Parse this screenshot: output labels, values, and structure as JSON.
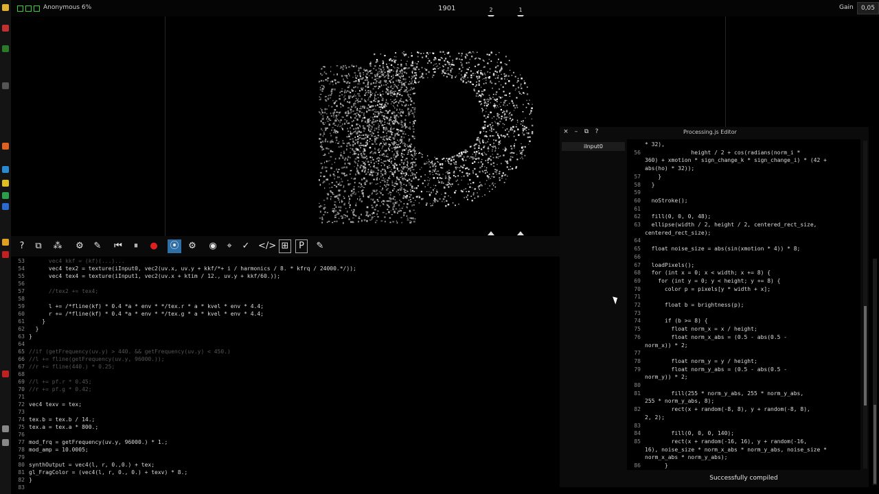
{
  "app": {
    "title": "Anonymous 6%",
    "frame": "1901"
  },
  "markers": [
    "2",
    "1"
  ],
  "gain": {
    "label": "Gain",
    "value": "0,05"
  },
  "toolbar": {
    "icons": [
      "help-icon",
      "windows-icon",
      "people-icon",
      "gear-icon",
      "brush-icon",
      "skip-back-icon",
      "pause-icon",
      "record-icon",
      "waveform-icon",
      "settings-icon",
      "eye-icon",
      "binoculars-icon",
      "check-icon",
      "code-icon",
      "add-icon",
      "processing-icon",
      "brush-icon"
    ],
    "glyphs": [
      "?",
      "⧉",
      "⁂",
      "⚙",
      "✎",
      "⏮",
      "⏸",
      "●",
      "⦿",
      "⚙",
      "◉",
      "⌖",
      "✓",
      "</>",
      "⊞",
      "P",
      "✎"
    ]
  },
  "code_lines": [
    {
      "n": "53",
      "t": "      vec4 kkf = (kf)(...)...",
      "d": true
    },
    {
      "n": "54",
      "t": "      vec4 tex2 = texture(iInput0, vec2(uv.x, uv.y + kkf/*+ i / harmonics / 8. * kfrq / 24000.*/));"
    },
    {
      "n": "55",
      "t": "      vec4 tex4 = texture(iInput1, vec2(uv.x + ktim / 12., uv.y + kkf/60.));"
    },
    {
      "n": "56",
      "t": ""
    },
    {
      "n": "57",
      "t": "      //tex2 += tex4;",
      "d": true
    },
    {
      "n": "58",
      "t": ""
    },
    {
      "n": "59",
      "t": "      l += /*fline(kf) * 0.4 *a * env * */tex.r * a * kvel * env * 4.4;"
    },
    {
      "n": "60",
      "t": "      r += /*fline(kf) * 0.4 *a * env * */tex.g * a * kvel * env * 4.4;"
    },
    {
      "n": "61",
      "t": "    }"
    },
    {
      "n": "62",
      "t": "  }"
    },
    {
      "n": "63",
      "t": "}"
    },
    {
      "n": "64",
      "t": ""
    },
    {
      "n": "65",
      "t": "//if (getFrequency(uv.y) > 440. && getFrequency(uv.y) < 450.)",
      "d": true
    },
    {
      "n": "66",
      "t": "//l += fline(getFrequency(uv.y, 96000.));",
      "d": true
    },
    {
      "n": "67",
      "t": "//r += fline(440.) * 0.25;",
      "d": true
    },
    {
      "n": "68",
      "t": ""
    },
    {
      "n": "69",
      "t": "//l += pf.r * 0.45;",
      "d": true
    },
    {
      "n": "70",
      "t": "//r += pf.g * 0.42;",
      "d": true
    },
    {
      "n": "71",
      "t": ""
    },
    {
      "n": "72",
      "t": "vec4 texv = tex;"
    },
    {
      "n": "73",
      "t": ""
    },
    {
      "n": "74",
      "t": "tex.b = tex.b / 14.;"
    },
    {
      "n": "75",
      "t": "tex.a = tex.a * 800.;"
    },
    {
      "n": "76",
      "t": ""
    },
    {
      "n": "77",
      "t": "mod_frq = getFrequency(uv.y, 96000.) * 1.;"
    },
    {
      "n": "78",
      "t": "mod_amp = 10.0005;"
    },
    {
      "n": "79",
      "t": ""
    },
    {
      "n": "80",
      "t": "synthOutput = vec4(l, r, 0.,0.) + tex;"
    },
    {
      "n": "81",
      "t": "gl_FragColor = (vec4(l, r, 0., 0.) + texv) * 8.;"
    },
    {
      "n": "82",
      "t": "}"
    },
    {
      "n": "83",
      "t": ""
    }
  ],
  "pjs": {
    "title": "Processing.js Editor",
    "tab": "iInput0",
    "buttons": [
      "×",
      "–",
      "⧉",
      "?"
    ],
    "lines": [
      {
        "n": "",
        "t": "* 32),"
      },
      {
        "n": "56",
        "t": "              height / 2 + cos(radians(norm_i *"
      },
      {
        "n": "",
        "t": "360) + xmotion * sign_change_k * sign_change_i) * (42 +"
      },
      {
        "n": "",
        "t": "abs(ho) * 32));"
      },
      {
        "n": "57",
        "t": "    }"
      },
      {
        "n": "58",
        "t": "  }"
      },
      {
        "n": "59",
        "t": ""
      },
      {
        "n": "60",
        "t": "  noStroke();"
      },
      {
        "n": "61",
        "t": ""
      },
      {
        "n": "62",
        "t": "  fill(0, 0, 0, 48);"
      },
      {
        "n": "63",
        "t": "  ellipse(width / 2, height / 2, centered_rect_size,"
      },
      {
        "n": "",
        "t": "centered_rect_size);"
      },
      {
        "n": "64",
        "t": ""
      },
      {
        "n": "65",
        "t": "  float noise_size = abs(sin(xmotion * 4)) * 8;"
      },
      {
        "n": "66",
        "t": ""
      },
      {
        "n": "67",
        "t": "  loadPixels();"
      },
      {
        "n": "68",
        "t": "  for (int x = 0; x < width; x += 8) {"
      },
      {
        "n": "69",
        "t": "    for (int y = 0; y < height; y += 8) {"
      },
      {
        "n": "70",
        "t": "      color p = pixels[y * width + x];"
      },
      {
        "n": "71",
        "t": ""
      },
      {
        "n": "72",
        "t": "      float b = brightness(p);"
      },
      {
        "n": "73",
        "t": ""
      },
      {
        "n": "74",
        "t": "      if (b >= 8) {"
      },
      {
        "n": "75",
        "t": "        float norm_x = x / height;"
      },
      {
        "n": "76",
        "t": "        float norm_x_abs = (0.5 - abs(0.5 -"
      },
      {
        "n": "",
        "t": "norm_x)) * 2;"
      },
      {
        "n": "77",
        "t": ""
      },
      {
        "n": "78",
        "t": "        float norm_y = y / height;"
      },
      {
        "n": "79",
        "t": "        float norm_y_abs = (0.5 - abs(0.5 -"
      },
      {
        "n": "",
        "t": "norm_y)) * 2;"
      },
      {
        "n": "80",
        "t": ""
      },
      {
        "n": "81",
        "t": "        fill(255 * norm_y_abs, 255 * norm_y_abs,"
      },
      {
        "n": "",
        "t": "255 * norm_y_abs, 8);"
      },
      {
        "n": "82",
        "t": "        rect(x + random(-8, 8), y + random(-8, 8),"
      },
      {
        "n": "",
        "t": "2, 2);"
      },
      {
        "n": "83",
        "t": ""
      },
      {
        "n": "84",
        "t": "        fill(0, 0, 0, 140);"
      },
      {
        "n": "85",
        "t": "        rect(x + random(-16, 16), y + random(-16,"
      },
      {
        "n": "",
        "t": "16), noise_size * norm_x_abs * norm_y_abs, noise_size *"
      },
      {
        "n": "",
        "t": "norm_x_abs * norm_y_abs);"
      },
      {
        "n": "86",
        "t": "      }"
      }
    ],
    "status": "Successfully compiled"
  }
}
